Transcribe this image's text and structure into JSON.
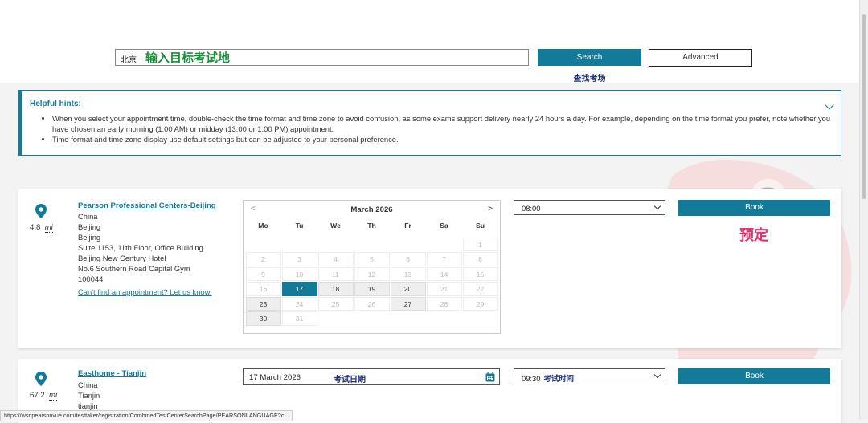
{
  "search": {
    "value": "北京",
    "annotation": "输入目标考试地",
    "search_label": "Search",
    "search_annotation": "查找考场",
    "advanced_label": "Advanced"
  },
  "hints": {
    "title": "Helpful hints:",
    "items": [
      "When you select your appointment time, double-check the time format and time zone to avoid confusion, as some exams support delivery nearly 24 hours a day. For example, depending on the time format you prefer, note whether you have chosen an early morning (1:00 AM) or midday (13:00 or 1:00 PM) appointment.",
      "Time format and time zone display use default settings but can be adjusted to your personal preference."
    ]
  },
  "centers": [
    {
      "name": "Pearson Professional Centers-Beijing",
      "distance": "4.8",
      "unit": "mi",
      "address": [
        "China",
        "Beijing",
        "Beijing",
        "Suite 1153, 11th Floor, Office Building",
        "Beijing New Century Hotel",
        "No.6 Southern Road Capital Gym",
        "100044"
      ],
      "cant_find": "Can't find an appointment? Let us know.",
      "calendar": {
        "month": "March 2026",
        "prev": "<",
        "next": ">",
        "dows": [
          "Mo",
          "Tu",
          "We",
          "Th",
          "Fr",
          "Sa",
          "Su"
        ],
        "leading_blanks": 6,
        "days": [
          "1",
          "2",
          "3",
          "4",
          "5",
          "6",
          "7",
          "8",
          "9",
          "10",
          "11",
          "12",
          "13",
          "14",
          "15",
          "16",
          "17",
          "18",
          "19",
          "20",
          "21",
          "22",
          "23",
          "24",
          "25",
          "26",
          "27",
          "28",
          "29",
          "30",
          "31"
        ],
        "available": [
          "18",
          "19",
          "20",
          "23",
          "27",
          "30"
        ],
        "selected": "17"
      },
      "time": "08:00",
      "book_label": "Book",
      "book_annotation": "预定"
    },
    {
      "name": "Easthome - Tianjin",
      "distance": "67.2",
      "unit": "mi",
      "address": [
        "China",
        "Tianjin",
        "tianjin"
      ],
      "date": "17 March 2026",
      "date_annotation": "考试日期",
      "time": "09:30",
      "time_annotation": "考试时间",
      "book_label": "Book"
    }
  ],
  "status_url": "https://wsr.pearsonvue.com/testtaker/registration/CombinedTestCenterSearchPage/PEARSONLANGUAGE?c...",
  "colors": {
    "accent": "#147a99",
    "annotation_green": "#1a8f3a",
    "annotation_pink": "#e8306f",
    "annotation_navy": "#1f2f6e"
  }
}
